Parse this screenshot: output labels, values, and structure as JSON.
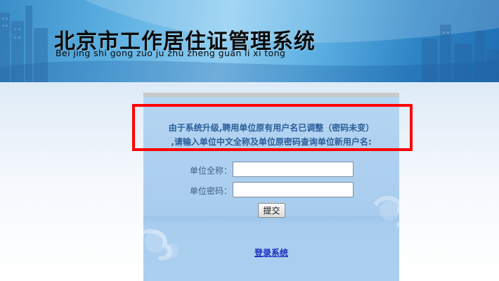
{
  "header": {
    "title": "北京市工作居住证管理系统",
    "pinyin": "Bei jing shi gong zuo ju zhu zheng guan li xi tong"
  },
  "notice": {
    "line1": "由于系统升级,聘用单位原有用户名已调整（密码未变）",
    "line2": ",请输入单位中文全称及单位原密码查询单位新用户名:"
  },
  "form": {
    "unit_name_label": "单位全称：",
    "unit_name_value": "",
    "unit_password_label": "单位密码：",
    "unit_password_value": "",
    "submit_label": "提交"
  },
  "login_link": "登录系统",
  "colors": {
    "highlight": "#ff0000",
    "panel": "#a9cdee",
    "notice_text": "#2b5d9a",
    "link": "#1a2fbf"
  }
}
